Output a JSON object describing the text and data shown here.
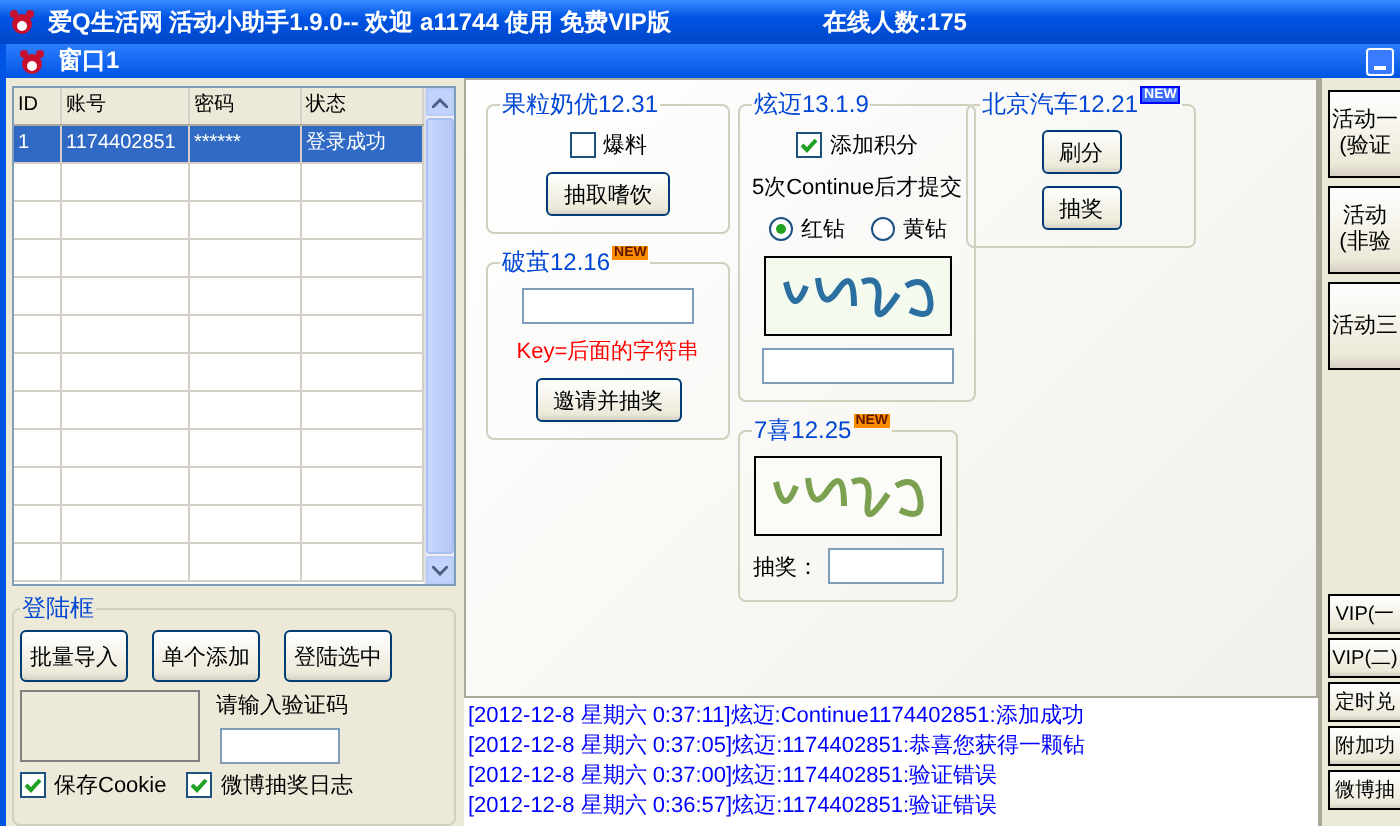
{
  "app_title": {
    "text": "爱Q生活网 活动小助手1.9.0-- 欢迎 a11744 使用 免费VIP版",
    "online": "在线人数:175"
  },
  "window": {
    "title": "窗口1"
  },
  "accounts": {
    "columns": [
      "ID",
      "账号",
      "密码",
      "状态"
    ],
    "rows": [
      {
        "cells": [
          "1",
          "1174402851",
          "******",
          "登录成功"
        ],
        "selected": true
      }
    ]
  },
  "login_box": {
    "title": "登陆框",
    "buttons": [
      "批量导入",
      "单个添加",
      "登陆选中"
    ],
    "captcha_label": "请输入验证码",
    "options": [
      {
        "label": "保存Cookie",
        "checked": true
      },
      {
        "label": "微博抽奖日志",
        "checked": true
      }
    ]
  },
  "columns": [
    [
      {
        "title": "果粒奶优12.31",
        "items": [
          {
            "kind": "checkbox",
            "label": "爆料",
            "checked": false
          },
          {
            "kind": "button",
            "label": "抽取嗜饮"
          }
        ]
      },
      {
        "title": "破茧12.16",
        "badge": {
          "text": "NEW",
          "kind": "filled"
        },
        "items": [
          {
            "kind": "field"
          },
          {
            "kind": "note",
            "text": "Key=后面的字符串"
          },
          {
            "kind": "button",
            "label": "邀请并抽奖"
          }
        ]
      }
    ],
    [
      {
        "title": "炫迈13.1.9",
        "items": [
          {
            "kind": "checkbox",
            "label": "添加积分",
            "checked": true
          },
          {
            "kind": "text",
            "text": "5次Continue后才提交"
          },
          {
            "kind": "radios",
            "options": [
              {
                "label": "红钻",
                "selected": true
              },
              {
                "label": "黄钻",
                "selected": false
              }
            ]
          },
          {
            "kind": "captcha"
          },
          {
            "kind": "field"
          }
        ]
      },
      {
        "title": "7喜12.25",
        "badge": {
          "text": "NEW",
          "kind": "filled"
        },
        "items": [
          {
            "kind": "captcha"
          },
          {
            "kind": "labeled-field",
            "label": "抽奖："
          }
        ]
      }
    ],
    [
      {
        "title": "北京汽车12.21",
        "badge": {
          "text": "NEW",
          "kind": "outline"
        },
        "items": [
          {
            "kind": "button",
            "label": "刷分"
          },
          {
            "kind": "button",
            "label": "抽奖"
          }
        ]
      }
    ]
  ],
  "log": [
    "[2012-12-8 星期六 0:37:11]炫迈:Continue1174402851:添加成功",
    "[2012-12-8 星期六 0:37:05]炫迈:1174402851:恭喜您获得一颗钻",
    "[2012-12-8 星期六 0:37:00]炫迈:1174402851:验证错误",
    "[2012-12-8 星期六 0:36:57]炫迈:1174402851:验证错误"
  ],
  "side_buttons": [
    {
      "kind": "large",
      "lines": [
        "活动一",
        "(验证"
      ]
    },
    {
      "kind": "large",
      "lines": [
        "活动",
        "(非验"
      ]
    },
    {
      "kind": "large",
      "lines": [
        "活动三"
      ]
    },
    {
      "kind": "small",
      "lines": [
        "VIP(一"
      ]
    },
    {
      "kind": "small",
      "lines": [
        "VIP(二)"
      ]
    },
    {
      "kind": "small",
      "lines": [
        "定时兑"
      ]
    },
    {
      "kind": "small",
      "lines": [
        "附加功"
      ]
    },
    {
      "kind": "small",
      "lines": [
        "微博抽"
      ]
    }
  ]
}
